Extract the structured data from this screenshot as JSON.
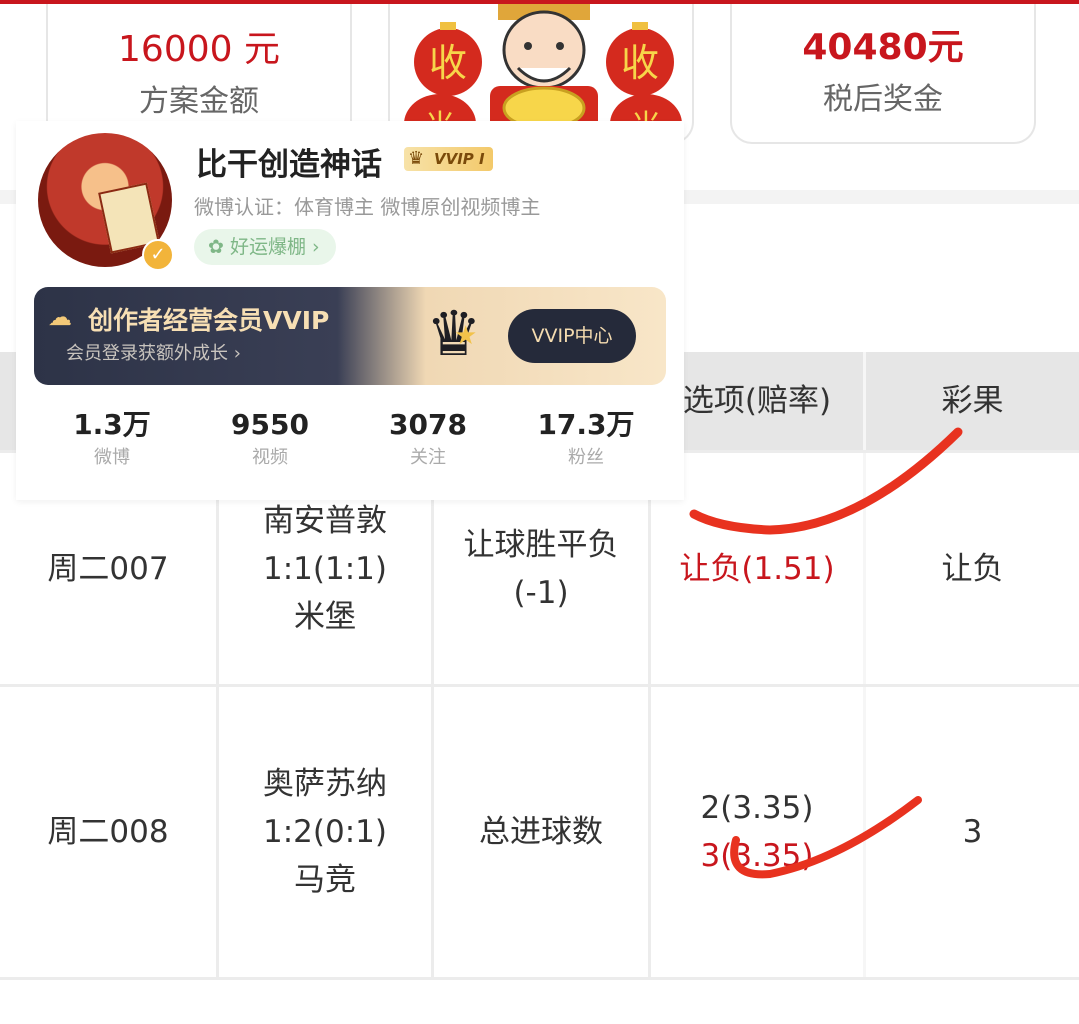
{
  "summary": {
    "plan_amount": "16000 元",
    "plan_amount_label": "方案金额",
    "after_tax": "40480元",
    "after_tax_label": "税后奖金",
    "banner_chars": [
      "收",
      "收",
      "米",
      "米"
    ]
  },
  "profile": {
    "name": "比干创造神话",
    "vvip_badge": "VVIP I",
    "certification": "微博认证：体育博主 微博原创视频博主",
    "luck_tag": "好运爆棚",
    "membership_title": "创作者经营会员VVIP",
    "membership_sub": "会员登录获额外成长",
    "vvip_center_button": "VVIP中心",
    "stats": [
      {
        "value": "1.3万",
        "label": "微博"
      },
      {
        "value": "9550",
        "label": "视频"
      },
      {
        "value": "3078",
        "label": "关注"
      },
      {
        "value": "17.3万",
        "label": "粉丝"
      }
    ]
  },
  "table": {
    "headers": {
      "option_odds": "选项(赔率)",
      "result": "彩果"
    },
    "rows": [
      {
        "match_no": "周二007",
        "match_line1": "南安普敦",
        "match_line2": "1:1(1:1)",
        "match_line3": "米堡",
        "play_line1": "让球胜平负",
        "play_line2": "(-1)",
        "option1": "让负(1.51)",
        "result": "让负"
      },
      {
        "match_no": "周二008",
        "match_line1": "奥萨苏纳",
        "match_line2": "1:2(0:1)",
        "match_line3": "马竞",
        "play_line1": "总进球数",
        "option1": "2(3.35)",
        "option2": "3(3.35)",
        "result": "3"
      }
    ]
  },
  "colors": {
    "accent_red": "#c8161d",
    "header_gray": "#e6e6e6",
    "check_mark": "#e8321f"
  }
}
